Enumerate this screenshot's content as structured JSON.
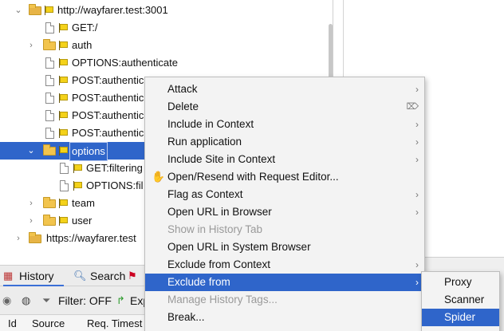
{
  "tree": {
    "root": "http://wayfarer.test:3001",
    "items": [
      {
        "label": "GET:/"
      },
      {
        "label": "auth"
      },
      {
        "label": "OPTIONS:authenticate"
      },
      {
        "label": "POST:authentic"
      },
      {
        "label": "POST:authentic"
      },
      {
        "label": "POST:authentic"
      },
      {
        "label": "POST:authentic"
      },
      {
        "label": "options"
      },
      {
        "label": "GET:filtering"
      },
      {
        "label": "OPTIONS:fil"
      },
      {
        "label": "team"
      },
      {
        "label": "user"
      }
    ],
    "second_root": "https://wayfarer.test"
  },
  "tabs": {
    "history": "History",
    "search": "Search"
  },
  "toolbar": {
    "filter": "Filter: OFF",
    "export": "Exp"
  },
  "columns": [
    "Id",
    "Source",
    "Req. Timest"
  ],
  "context_menu": {
    "items": [
      {
        "label": "Attack",
        "submenu": true
      },
      {
        "label": "Delete"
      },
      {
        "label": "Include in Context",
        "submenu": true
      },
      {
        "label": "Run application",
        "submenu": true
      },
      {
        "label": "Include Site in Context",
        "submenu": true
      },
      {
        "label": "Open/Resend with Request Editor..."
      },
      {
        "label": "Flag as Context",
        "submenu": true
      },
      {
        "label": "Open URL in Browser",
        "submenu": true
      },
      {
        "label": "Show in History Tab"
      },
      {
        "label": "Open URL in System Browser"
      },
      {
        "label": "Exclude from Context",
        "submenu": true
      },
      {
        "label": "Exclude from",
        "submenu": true
      },
      {
        "label": "Manage History Tags..."
      },
      {
        "label": "Break..."
      }
    ]
  },
  "submenu": {
    "items": [
      "Proxy",
      "Scanner",
      "Spider"
    ]
  },
  "colors": {
    "selection": "#2f65ca",
    "folder": "#f2c44d",
    "flag": "#f4d21a"
  }
}
